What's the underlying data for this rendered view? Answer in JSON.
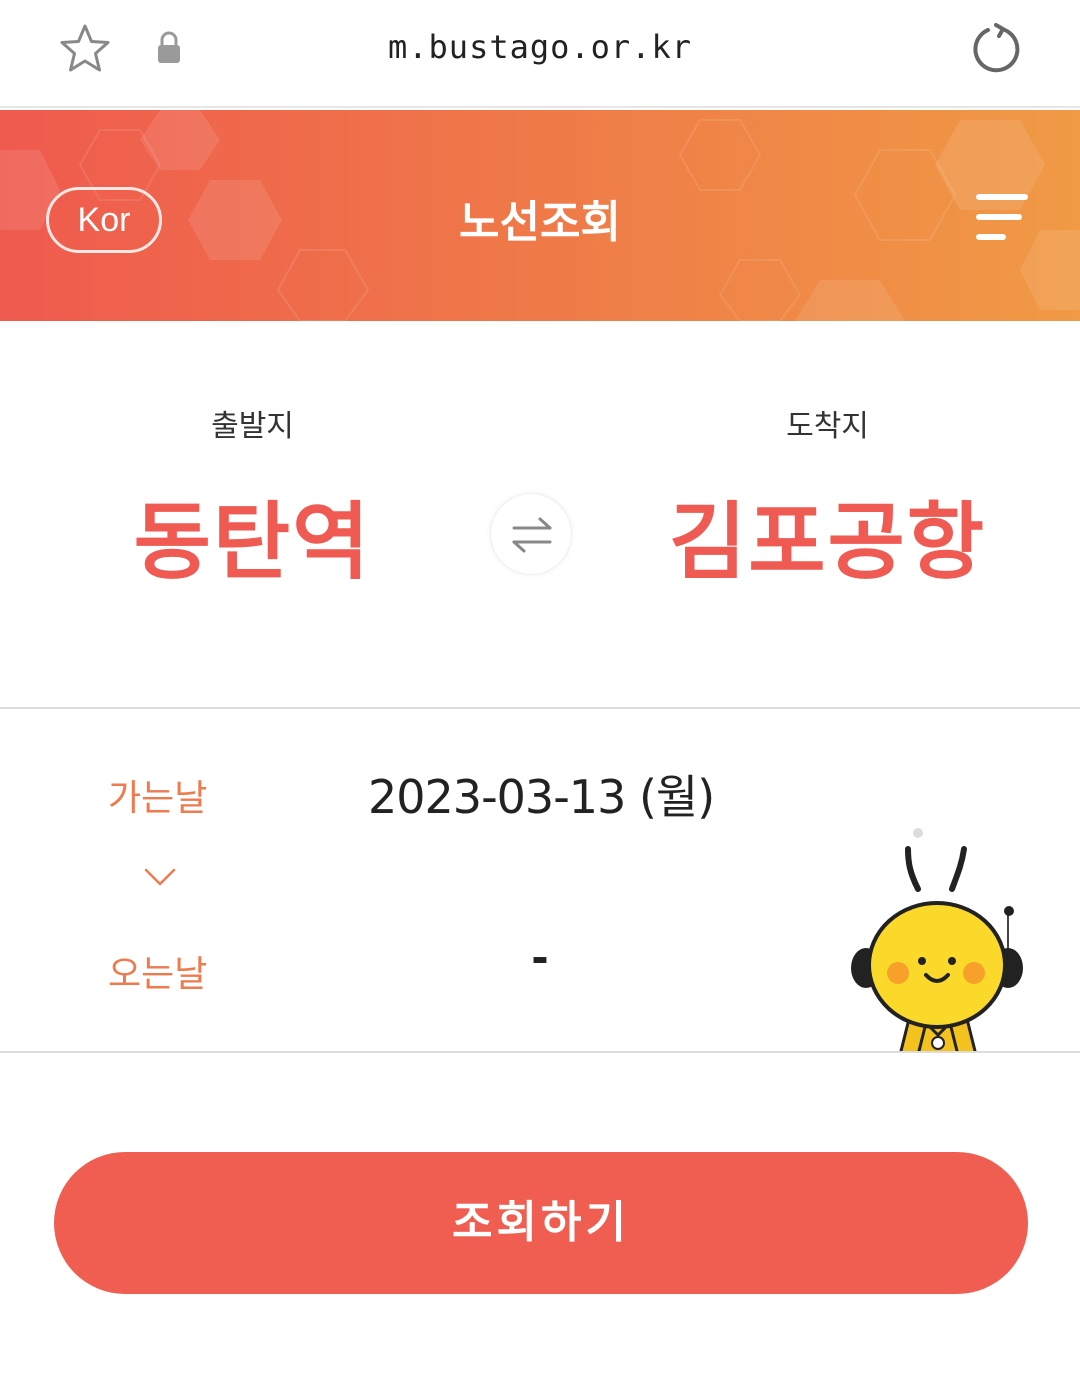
{
  "browser": {
    "url": "m.bustago.or.kr",
    "icons": [
      "star-icon",
      "lock-icon",
      "reload-icon"
    ]
  },
  "header": {
    "lang_label": "Kor",
    "title": "노선조회",
    "menu_icon": "hamburger-menu-icon"
  },
  "route": {
    "departure_label": "출발지",
    "departure_value": "동탄역",
    "arrival_label": "도착지",
    "arrival_value": "김포공항",
    "swap_icon": "swap-arrows-icon"
  },
  "dates": {
    "go_label": "가는날",
    "go_value": "2023-03-13 (월)",
    "return_label": "오는날",
    "return_value": "-",
    "chevron_icon": "chevron-down-icon"
  },
  "search": {
    "button_label": "조회하기"
  },
  "colors": {
    "accent": "#ef5a52",
    "header_start": "#ef5a4e",
    "header_end": "#f09a45",
    "date_label": "#ef7a4e"
  }
}
